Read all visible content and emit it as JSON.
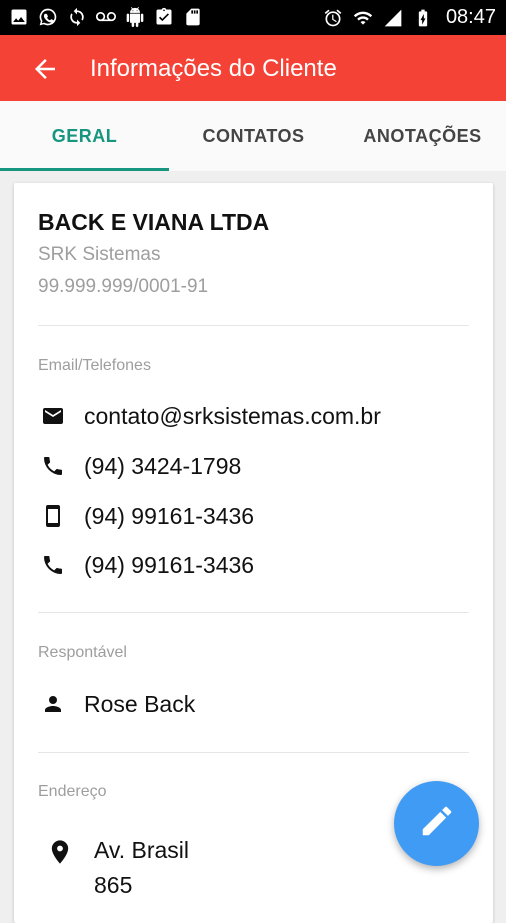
{
  "status_bar": {
    "time": "08:47",
    "left_icons": [
      "image-icon",
      "whatsapp-icon",
      "sync-icon",
      "voicemail-icon",
      "android-icon",
      "clipboard-icon",
      "sdcard-icon"
    ],
    "right_icons": [
      "alarm-icon",
      "wifi-icon",
      "signal-icon",
      "battery-charging-icon"
    ]
  },
  "app_bar": {
    "title": "Informações do Cliente",
    "accent": "#f44336"
  },
  "tabs": [
    {
      "label": "GERAL",
      "active": true
    },
    {
      "label": "CONTATOS",
      "active": false
    },
    {
      "label": "ANOTAÇÕES",
      "active": false
    }
  ],
  "tab_accent": "#16957f",
  "client": {
    "name": "BACK E VIANA LTDA",
    "company": "SRK Sistemas",
    "cnpj": "99.999.999/0001-91"
  },
  "contacts_section": {
    "label": "Email/Telefones",
    "items": [
      {
        "icon": "email-icon",
        "value": "contato@srksistemas.com.br"
      },
      {
        "icon": "phone-icon",
        "value": "(94) 3424-1798"
      },
      {
        "icon": "mobile-icon",
        "value": "(94) 99161-3436"
      },
      {
        "icon": "phone-icon",
        "value": "(94) 99161-3436"
      }
    ]
  },
  "responsible_section": {
    "label": "Respontável",
    "name": "Rose Back"
  },
  "address_section": {
    "label": "Endereço",
    "line1": "Av. Brasil",
    "line2": "865"
  },
  "fab": {
    "icon": "edit-icon",
    "color": "#3f9bf3"
  }
}
